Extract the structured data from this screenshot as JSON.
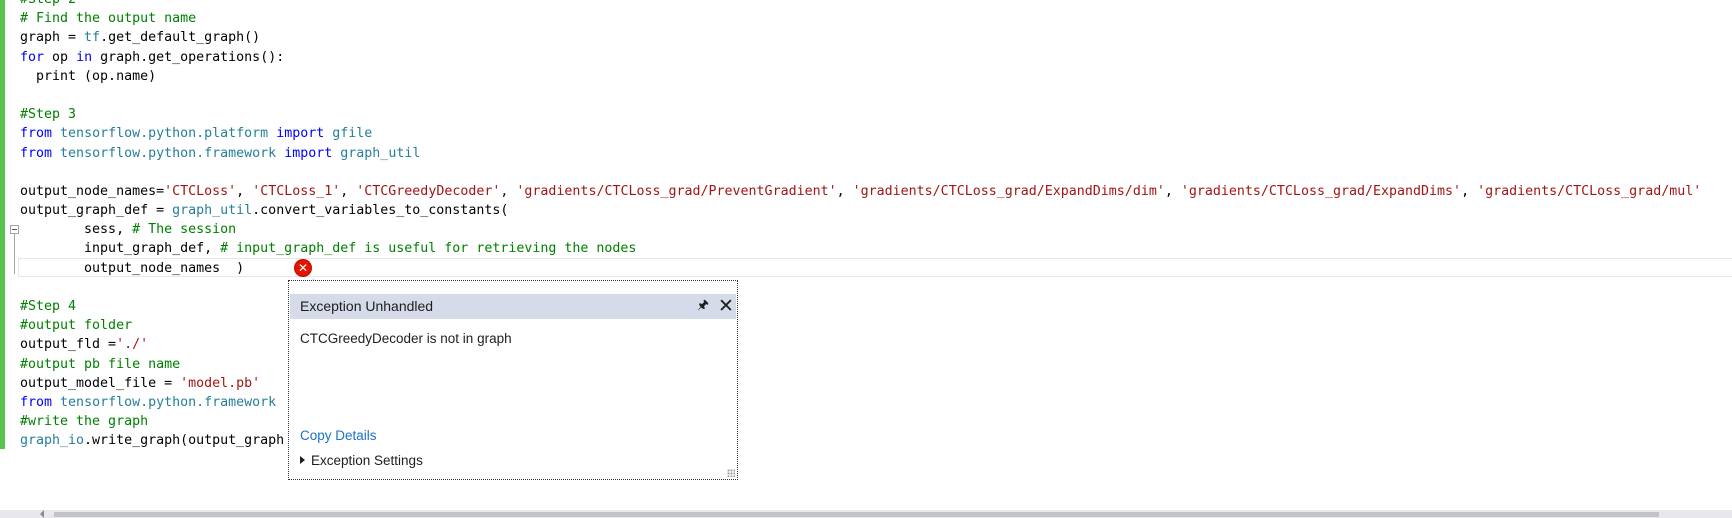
{
  "code_lines": [
    [
      {
        "t": "#Step 2",
        "c": "cm"
      }
    ],
    [
      {
        "t": "# Find the output name",
        "c": "cm"
      }
    ],
    [
      {
        "t": "graph = "
      },
      {
        "t": "tf",
        "c": "md"
      },
      {
        "t": ".get_default_graph()"
      }
    ],
    [
      {
        "t": "for",
        "c": "kw"
      },
      {
        "t": " op "
      },
      {
        "t": "in",
        "c": "kw"
      },
      {
        "t": " graph.get_operations():"
      }
    ],
    [
      {
        "t": "  print (op.name)"
      }
    ],
    [
      {
        "t": ""
      }
    ],
    [
      {
        "t": "#Step 3",
        "c": "cm"
      }
    ],
    [
      {
        "t": "from",
        "c": "kw"
      },
      {
        "t": " "
      },
      {
        "t": "tensorflow.python.platform",
        "c": "md"
      },
      {
        "t": " "
      },
      {
        "t": "import",
        "c": "kw"
      },
      {
        "t": " "
      },
      {
        "t": "gfile",
        "c": "md"
      }
    ],
    [
      {
        "t": "from",
        "c": "kw"
      },
      {
        "t": " "
      },
      {
        "t": "tensorflow.python.framework",
        "c": "md"
      },
      {
        "t": " "
      },
      {
        "t": "import",
        "c": "kw"
      },
      {
        "t": " "
      },
      {
        "t": "graph_util",
        "c": "md"
      }
    ],
    [
      {
        "t": ""
      }
    ],
    [
      {
        "t": "output_node_names="
      },
      {
        "t": "'CTCLoss'",
        "c": "st"
      },
      {
        "t": ", "
      },
      {
        "t": "'CTCLoss_1'",
        "c": "st"
      },
      {
        "t": ", "
      },
      {
        "t": "'CTCGreedyDecoder'",
        "c": "st"
      },
      {
        "t": ", "
      },
      {
        "t": "'gradients/CTCLoss_grad/PreventGradient'",
        "c": "st"
      },
      {
        "t": ", "
      },
      {
        "t": "'gradients/CTCLoss_grad/ExpandDims/dim'",
        "c": "st"
      },
      {
        "t": ", "
      },
      {
        "t": "'gradients/CTCLoss_grad/ExpandDims'",
        "c": "st"
      },
      {
        "t": ", "
      },
      {
        "t": "'gradients/CTCLoss_grad/mul'",
        "c": "st"
      }
    ],
    [
      {
        "t": "output_graph_def = "
      },
      {
        "t": "graph_util",
        "c": "md"
      },
      {
        "t": ".convert_variables_to_constants("
      }
    ],
    [
      {
        "t": "        sess, "
      },
      {
        "t": "# The session",
        "c": "cm"
      }
    ],
    [
      {
        "t": "        input_graph_def, "
      },
      {
        "t": "# input_graph_def is useful for retrieving the nodes",
        "c": "cm"
      }
    ],
    [
      {
        "t": "        output_node_names  )"
      }
    ],
    [
      {
        "t": ""
      }
    ],
    [
      {
        "t": "#Step 4",
        "c": "cm"
      }
    ],
    [
      {
        "t": "#output folder",
        "c": "cm"
      }
    ],
    [
      {
        "t": "output_fld ="
      },
      {
        "t": "'./'",
        "c": "st"
      }
    ],
    [
      {
        "t": "#output pb file name",
        "c": "cm"
      }
    ],
    [
      {
        "t": "output_model_file = "
      },
      {
        "t": "'model.pb'",
        "c": "st"
      }
    ],
    [
      {
        "t": "from",
        "c": "kw"
      },
      {
        "t": " "
      },
      {
        "t": "tensorflow.python.framework",
        "c": "md"
      }
    ],
    [
      {
        "t": "#write the graph",
        "c": "cm"
      }
    ],
    [
      {
        "t": "graph_io",
        "c": "md"
      },
      {
        "t": ".write_graph(output_graph"
      }
    ]
  ],
  "exception_popup": {
    "title": "Exception Unhandled",
    "message": "CTCGreedyDecoder is not in graph",
    "copy_details_label": "Copy Details",
    "exception_settings_label": "Exception Settings"
  },
  "icons": {
    "error": "error-x-icon",
    "pin": "pin-icon",
    "close": "close-icon"
  },
  "colors": {
    "keyword": "#0000ff",
    "comment": "#008000",
    "string": "#a31515",
    "module": "#267f99",
    "change_bar": "#57c54d",
    "popup_header": "#d6dbe9",
    "link": "#1a73c9",
    "error": "#e51400"
  }
}
